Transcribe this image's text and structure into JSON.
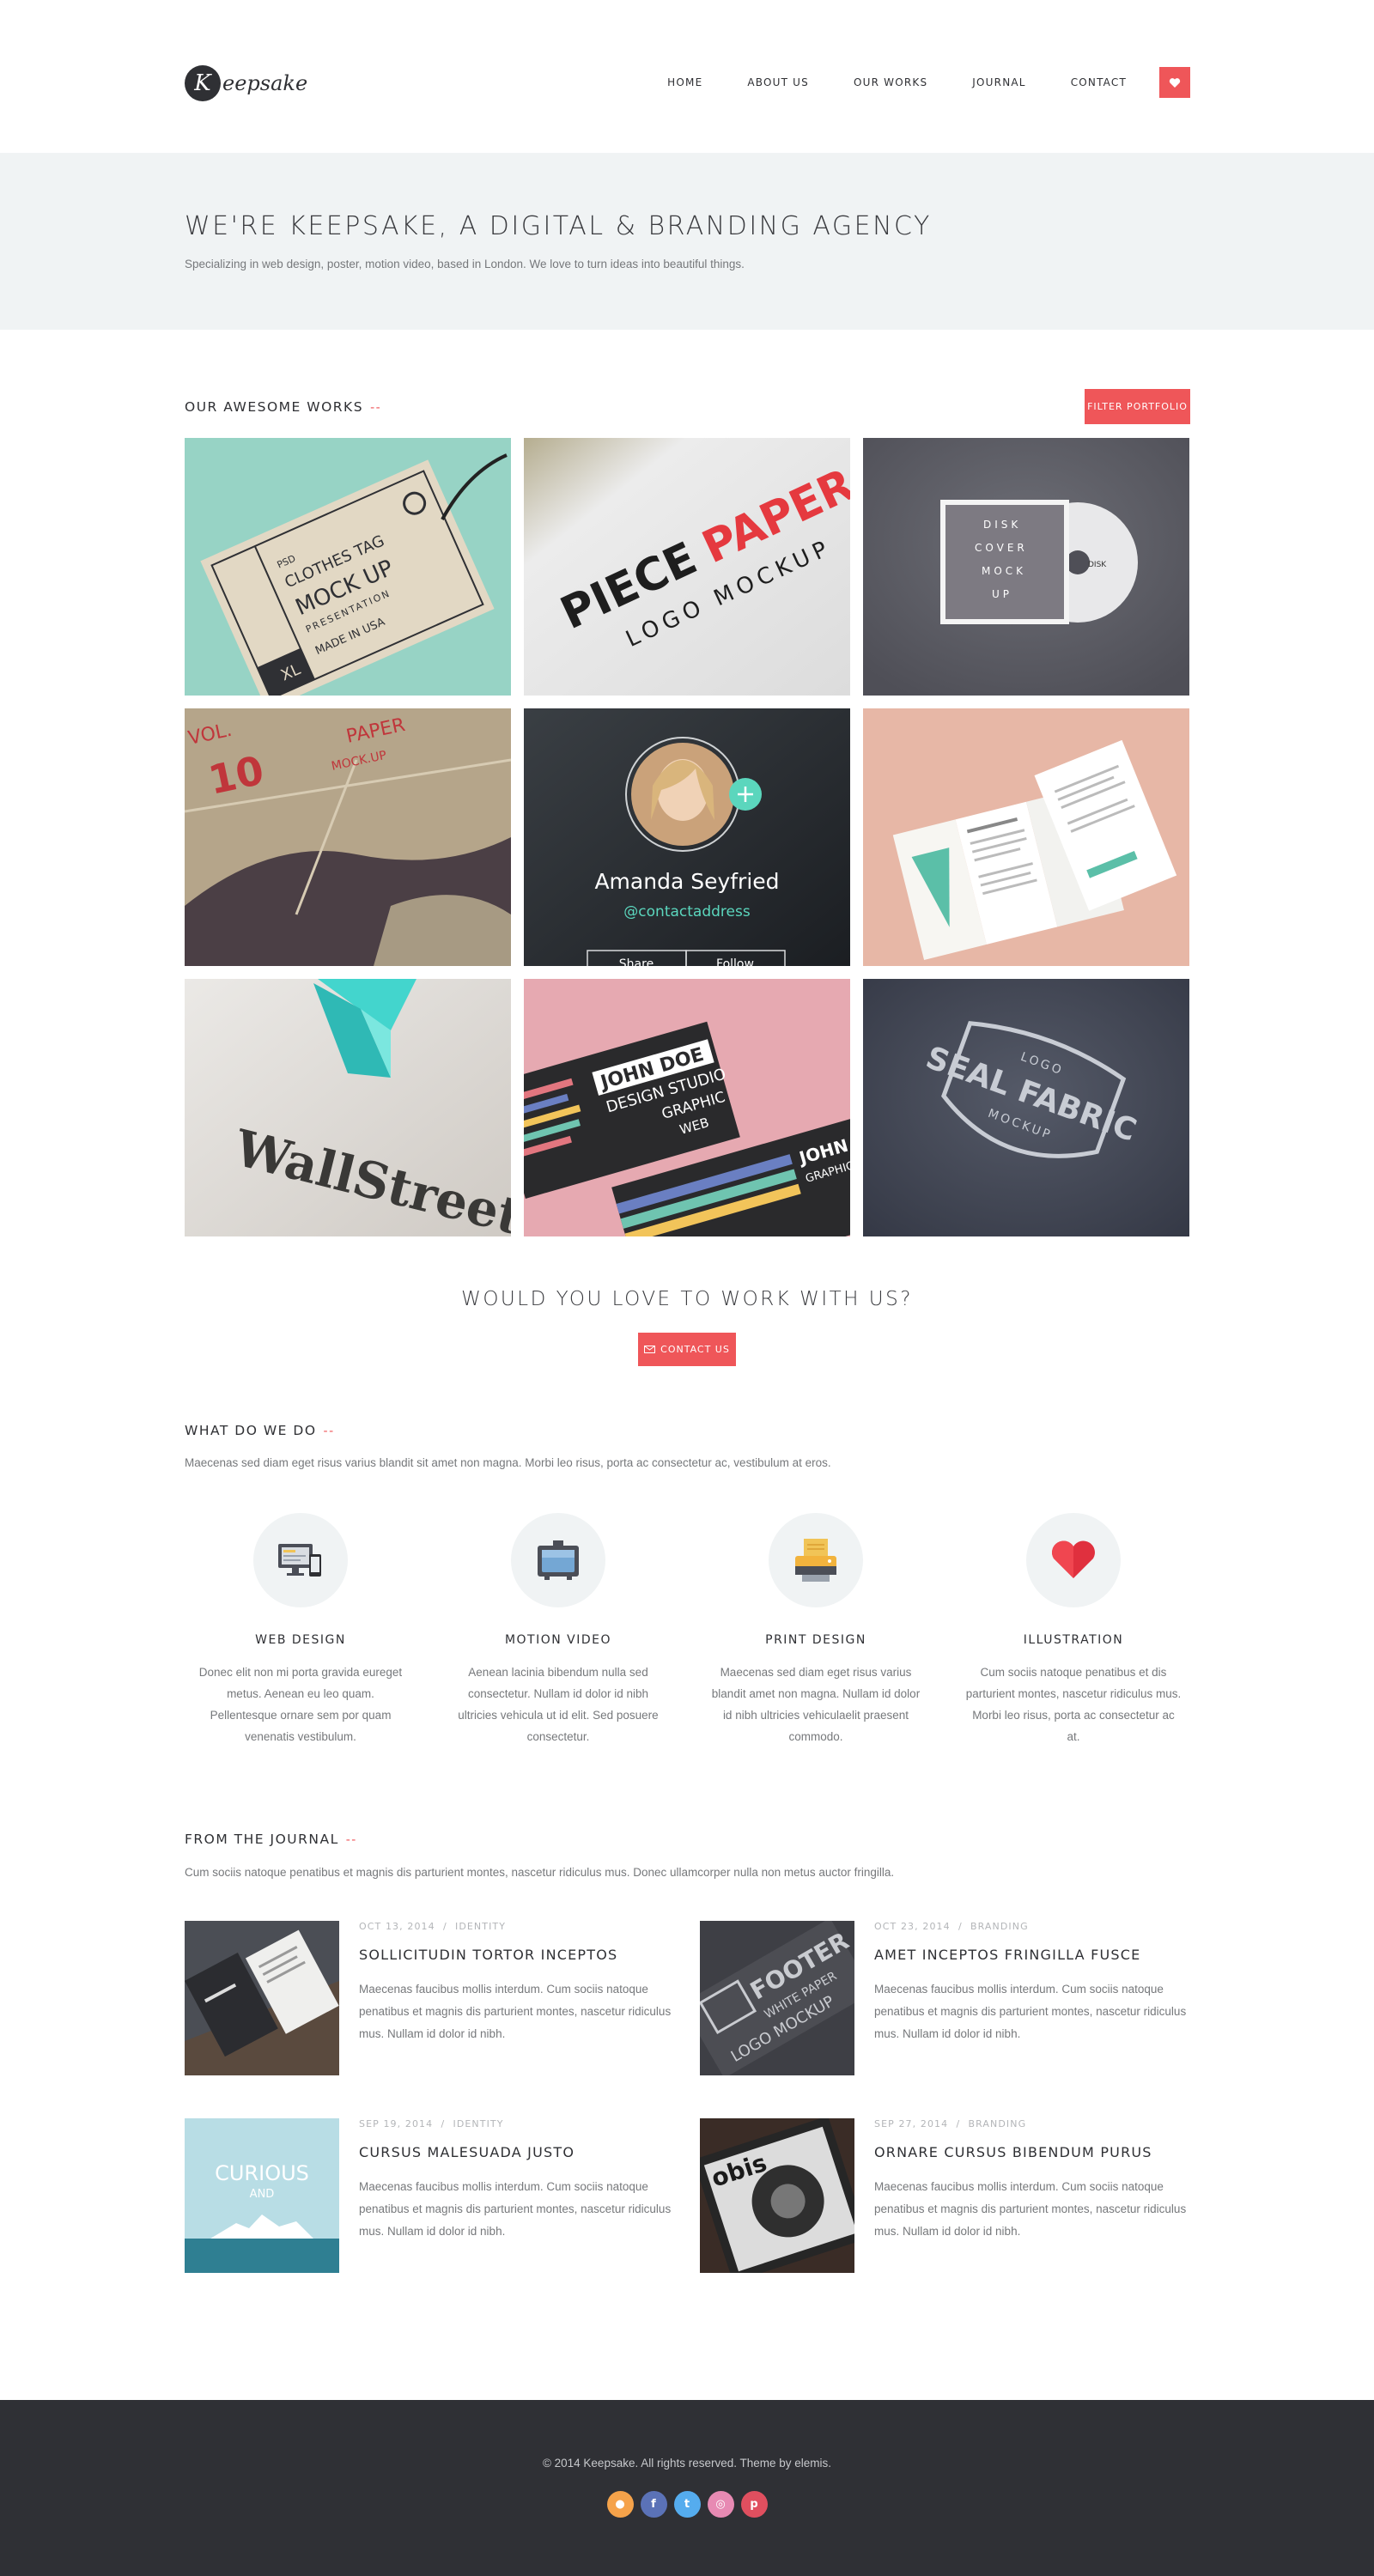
{
  "brand": {
    "logo_letter": "K",
    "logo_text": "eepsake"
  },
  "nav": {
    "items": [
      "HOME",
      "ABOUT US",
      "OUR WORKS",
      "JOURNAL",
      "CONTACT"
    ],
    "heart_icon": "heart-icon"
  },
  "hero": {
    "title": "WE'RE KEEPSAKE, A DIGITAL & BRANDING AGENCY",
    "subtitle": "Specializing in web design, poster, motion video, based in London. We love to turn ideas into beautiful things."
  },
  "works": {
    "title": "OUR AWESOME WORKS",
    "dash": "--",
    "filter_button": "FILTER PORTFOLIO",
    "tiles": [
      {
        "tag_lines": [
          "PSD",
          "CLOTHES TAG",
          "MOCK UP",
          "PRESENTATION",
          "MADE IN USA",
          "XL"
        ]
      },
      {
        "brand_a": "PIECE",
        "brand_b": "PAPER",
        "line2": "LOGO MOCKUP"
      },
      {
        "cover_lines": [
          "DISK",
          "COVER",
          "MOCK",
          "UP"
        ],
        "disc_label": "DISK"
      },
      {
        "lines": [
          "VOL.",
          "10",
          "PAPER",
          "MOCK.UP"
        ]
      },
      {
        "name": "Amanda Seyfried",
        "handle": "@contactaddress",
        "btn_a": "Share",
        "btn_b": "Follow"
      },
      {
        "label": "brochure"
      },
      {
        "logo_text": "WallStreet"
      },
      {
        "card_lines": [
          "JOHN DOE",
          "DESIGN STUDIO",
          "GRAPHIC",
          "WEB",
          "JOHN",
          "GRAPHIC DES"
        ]
      },
      {
        "seal_top": "LOGO",
        "seal_main": "SEAL FABRIC",
        "seal_bottom": "MOCKUP"
      }
    ]
  },
  "cta": {
    "title": "WOULD YOU LOVE TO WORK WITH US?",
    "button": "CONTACT US",
    "button_icon": "envelope-icon"
  },
  "services": {
    "title": "WHAT DO WE DO",
    "dash": "--",
    "intro": "Maecenas sed diam eget risus varius blandit sit amet non magna. Morbi leo risus, porta ac consectetur ac, vestibulum at eros.",
    "items": [
      {
        "icon": "devices-icon",
        "title": "WEB DESIGN",
        "text": "Donec elit non mi porta gravida eureget metus. Aenean eu leo quam. Pellentesque ornare sem por quam venenatis vestibulum."
      },
      {
        "icon": "tv-icon",
        "title": "MOTION VIDEO",
        "text": "Aenean lacinia bibendum nulla sed consectetur. Nullam id dolor id nibh ultricies vehicula ut id elit. Sed posuere consectetur."
      },
      {
        "icon": "printer-icon",
        "title": "PRINT DESIGN",
        "text": "Maecenas sed diam eget risus varius blandit amet non magna. Nullam id dolor id nibh ultricies vehiculaelit praesent commodo."
      },
      {
        "icon": "heart-icon",
        "title": "ILLUSTRATION",
        "text": "Cum sociis natoque penatibus et dis parturient montes, nascetur ridiculus mus. Morbi leo risus, porta ac consectetur ac at."
      }
    ]
  },
  "journal": {
    "title": "FROM THE JOURNAL",
    "dash": "--",
    "intro": "Cum sociis natoque penatibus et magnis dis parturient montes, nascetur ridiculus mus. Donec ullamcorper nulla non metus auctor fringilla.",
    "posts": [
      {
        "date": "OCT 13, 2014",
        "sep": "/",
        "category": "IDENTITY",
        "title": "SOLLICITUDIN TORTOR INCEPTOS",
        "text": "Maecenas faucibus mollis interdum. Cum sociis natoque penatibus et magnis dis parturient montes, nascetur ridiculus mus. Nullam id dolor id nibh."
      },
      {
        "date": "OCT 23, 2014",
        "sep": "/",
        "category": "BRANDING",
        "title": "AMET INCEPTOS FRINGILLA FUSCE",
        "text": "Maecenas faucibus mollis interdum. Cum sociis natoque penatibus et magnis dis parturient montes, nascetur ridiculus mus. Nullam id dolor id nibh.",
        "thumb_lines": [
          "FOOTER",
          "WHITE PAPER",
          "LOGO MOCKUP"
        ]
      },
      {
        "date": "SEP 19, 2014",
        "sep": "/",
        "category": "IDENTITY",
        "title": "CURSUS MALESUADA JUSTO",
        "text": "Maecenas faucibus mollis interdum. Cum sociis natoque penatibus et magnis dis parturient montes, nascetur ridiculus mus. Nullam id dolor id nibh.",
        "thumb_lines": [
          "CURIOUS",
          "AND"
        ]
      },
      {
        "date": "SEP 27, 2014",
        "sep": "/",
        "category": "BRANDING",
        "title": "ORNARE CURSUS BIBENDUM PURUS",
        "text": "Maecenas faucibus mollis interdum. Cum sociis natoque penatibus et magnis dis parturient montes, nascetur ridiculus mus. Nullam id dolor id nibh.",
        "thumb_lines": [
          "obis"
        ]
      }
    ]
  },
  "footer": {
    "copyright": "© 2014 Keepsake. All rights reserved. Theme by elemis.",
    "socials": [
      {
        "icon": "rss-icon",
        "color": "#f5a24a",
        "glyph": "●"
      },
      {
        "icon": "facebook-icon",
        "color": "#5b72b7",
        "glyph": "f"
      },
      {
        "icon": "twitter-icon",
        "color": "#55acee",
        "glyph": "t"
      },
      {
        "icon": "dribbble-icon",
        "color": "#e78ab3",
        "glyph": "◎"
      },
      {
        "icon": "pinterest-icon",
        "color": "#e04f5f",
        "glyph": "p"
      }
    ]
  },
  "colors": {
    "accent": "#ef5659",
    "dark": "#2f3035",
    "light_bg": "#f0f3f4",
    "teal": "#5bd6bd"
  }
}
